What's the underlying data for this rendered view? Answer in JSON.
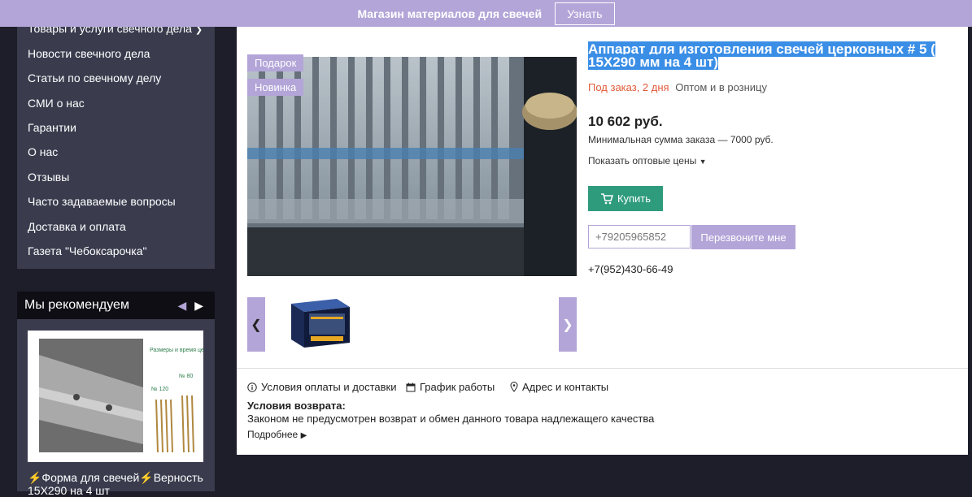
{
  "topbar": {
    "text": "Магазин материалов для свечей",
    "button": "Узнать"
  },
  "sidebar": {
    "items": [
      "Товары и услуги свечного дела",
      "Новости свечного дела",
      "Статьи по свечному делу",
      "СМИ о нас",
      "Гарантии",
      "О нас",
      "Отзывы",
      "Часто задаваемые вопросы",
      "Доставка и оплата",
      "Газета \"Чебоксарочка\""
    ]
  },
  "recommend": {
    "title": "Мы рекомендуем",
    "caption": "⚡Форма для свечей⚡Верность 15Х290 на 4 шт",
    "image_text": {
      "heading": "Размеры и время церковных свечей.",
      "no80": "№ 80",
      "no120": "№ 120"
    }
  },
  "product": {
    "badges": [
      "Подарок",
      "Новинка"
    ],
    "title": "Аппарат для изготовления свечей церковных # 5 ( 15Х290 мм на 4 шт)",
    "availability": "Под заказ, 2 дня",
    "sale_type": "Оптом и в розницу",
    "price": "10 602 руб.",
    "min_order": "Минимальная сумма заказа — 7000 руб.",
    "wholesale_link": "Показать оптовые цены",
    "buy_label": "Купить",
    "phone_placeholder": "+79205965852",
    "callback_label": "Перезвоните мне",
    "phone": "+7(952)430-66-49"
  },
  "info": {
    "payment": "Условия оплаты и доставки",
    "schedule": "График работы",
    "address": "Адрес и контакты",
    "return_title": "Условия возврата:",
    "return_text": "Законом не предусмотрен возврат и обмен данного товара надлежащего качества",
    "more": "Подробнее"
  },
  "colors": {
    "accent": "#b3a5d8",
    "buy": "#2f9b7d",
    "sidebar": "#3a3c4e",
    "background": "#1e1e2b",
    "availability": "#e05a3a"
  }
}
